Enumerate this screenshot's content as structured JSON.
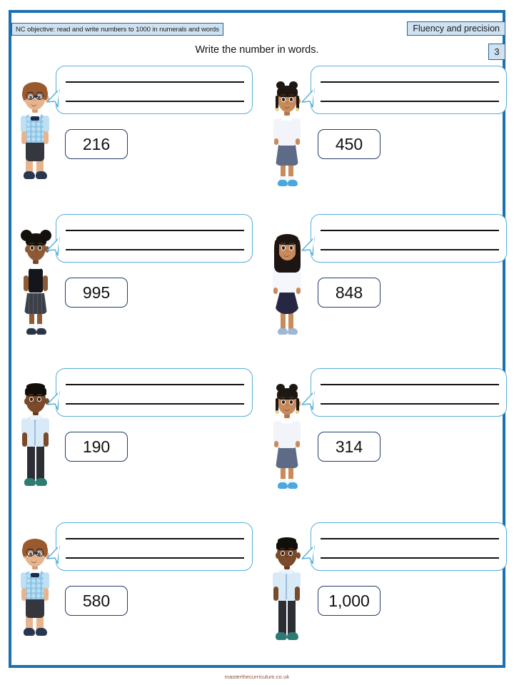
{
  "header": {
    "nc_objective": "NC objective: read and write numbers to 1000 in numerals and words",
    "strand": "Fluency and precision",
    "question_number": "3"
  },
  "title": "Write the number in words.",
  "questions": [
    {
      "number": "216",
      "character": "boy-glasses-bowtie"
    },
    {
      "number": "450",
      "character": "girl-buns-blouse"
    },
    {
      "number": "995",
      "character": "girl-afropuffs-vest"
    },
    {
      "number": "848",
      "character": "girl-longhair-navyskirt"
    },
    {
      "number": "190",
      "character": "boy-shortcrop-blueshirt"
    },
    {
      "number": "314",
      "character": "girl-buns-blouse"
    },
    {
      "number": "580",
      "character": "boy-glasses-bowtie"
    },
    {
      "number": "1,000",
      "character": "boy-shortcrop-blueshirt"
    }
  ],
  "footer": {
    "credit": "masterthecurriculum.co.uk"
  },
  "colors": {
    "page_border": "#1B70B0",
    "badge_fill": "#CFE2F2",
    "badge_border": "#2E5F8A",
    "bubble_border": "#54AFD8",
    "number_box_border": "#253B66",
    "answer_line": "#111111",
    "footer_text": "#8A4A3A"
  }
}
